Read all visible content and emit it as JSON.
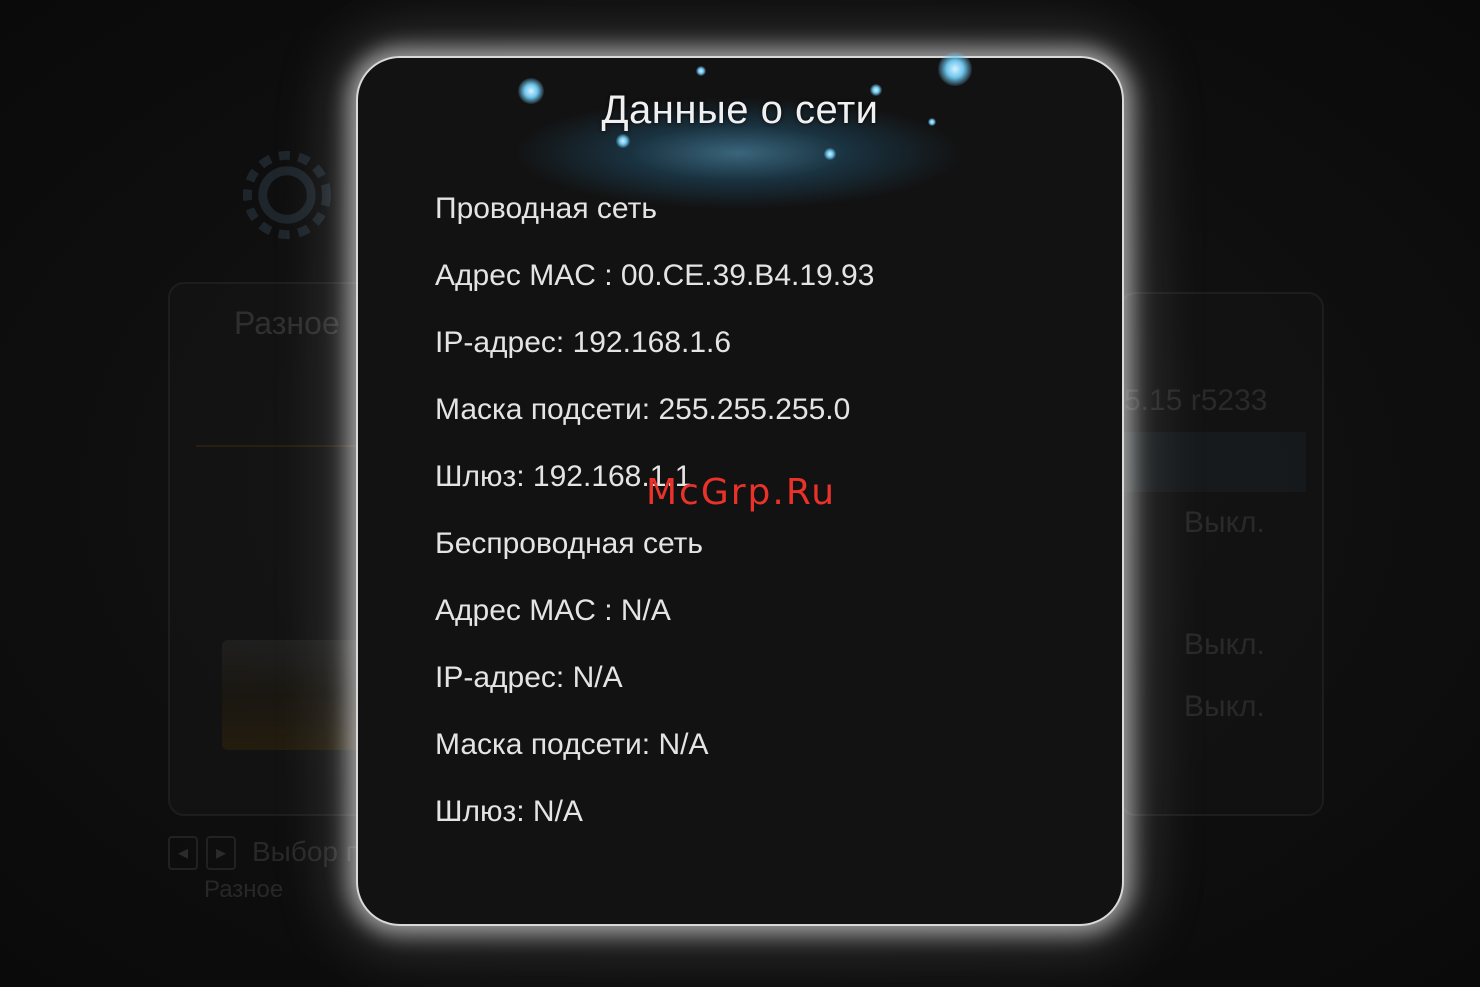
{
  "background": {
    "left_panel_label": "Разное",
    "right_version_text": "5.15 r5233",
    "right_values": [
      "Выкл.",
      "Выкл.",
      "Выкл."
    ],
    "hint_text": "Выбор п",
    "footer_label": "Разное"
  },
  "dialog": {
    "title": "Данные о сети",
    "lines": [
      "Проводная сеть",
      "Адрес MAC : 00.CE.39.B4.19.93",
      "IP-адрес: 192.168.1.6",
      "Маска подсети: 255.255.255.0",
      "Шлюз: 192.168.1.1",
      "Беспроводная сеть",
      "Адрес MAC : N/A",
      "IP-адрес: N/A",
      "Маска подсети: N/A",
      "Шлюз: N/A"
    ]
  },
  "watermark": "McGrp.Ru",
  "colors": {
    "dialog_border": "#d9d9d9",
    "title_glow": "#5aaad2",
    "watermark": "#e8322a"
  }
}
